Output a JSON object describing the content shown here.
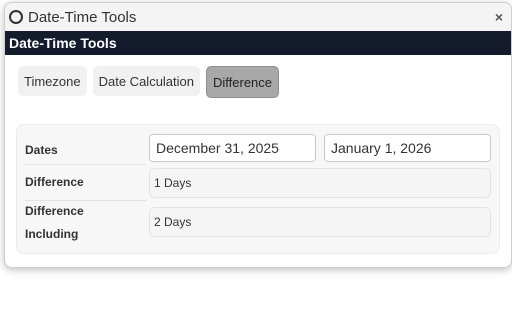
{
  "window": {
    "title": "Date-Time Tools",
    "close_glyph": "×"
  },
  "header": {
    "title": "Date-Time Tools"
  },
  "tabs": [
    {
      "label": "Timezone",
      "active": false
    },
    {
      "label": "Date Calculation",
      "active": false
    },
    {
      "label": "Difference",
      "active": true
    }
  ],
  "difference": {
    "dates_label": "Dates",
    "start_date": "December 31, 2025",
    "end_date": "January 1, 2026",
    "difference_label": "Difference",
    "difference_value": "1 Days",
    "difference_including_label_line1": "Difference",
    "difference_including_label_line2": "Including",
    "difference_including_value": "2 Days"
  },
  "colors": {
    "header_bg": "#141b2d",
    "active_tab_bg": "#a8a8a8"
  }
}
